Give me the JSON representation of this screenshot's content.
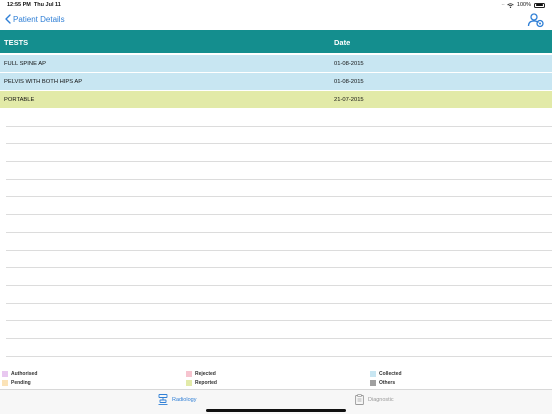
{
  "status_bar": {
    "time": "12:55 PM",
    "date": "Thu Jul 11",
    "battery": "100%"
  },
  "nav": {
    "back_label": "Patient Details"
  },
  "table": {
    "columns": [
      "TESTS",
      "Date"
    ],
    "rows": [
      {
        "test": "FULL SPINE AP",
        "date": "01-08-2015",
        "status": "Collected"
      },
      {
        "test": "PELVIS WITH BOTH HIPS AP",
        "date": "01-08-2015",
        "status": "Collected"
      },
      {
        "test": "PORTABLE",
        "date": "21-07-2015",
        "status": "Reported"
      }
    ]
  },
  "legend": [
    {
      "label": "Authorised",
      "color": "#e8c8f0"
    },
    {
      "label": "Rejected",
      "color": "#f6c4cf"
    },
    {
      "label": "Collected",
      "color": "#c8e6f2"
    },
    {
      "label": "Pending",
      "color": "#fbe3b8"
    },
    {
      "label": "Reported",
      "color": "#e2eaa8"
    },
    {
      "label": "Others",
      "color": "#a0a0a0"
    }
  ],
  "colors": {
    "header_bg": "#148e8e",
    "collected": "#c8e6f2",
    "reported": "#e2eaa8",
    "accent": "#2f7fd6"
  },
  "tabs": [
    {
      "label": "Radiology",
      "active": true,
      "icon": "radiology-icon"
    },
    {
      "label": "Diagnostic",
      "active": false,
      "icon": "clipboard-icon"
    }
  ]
}
